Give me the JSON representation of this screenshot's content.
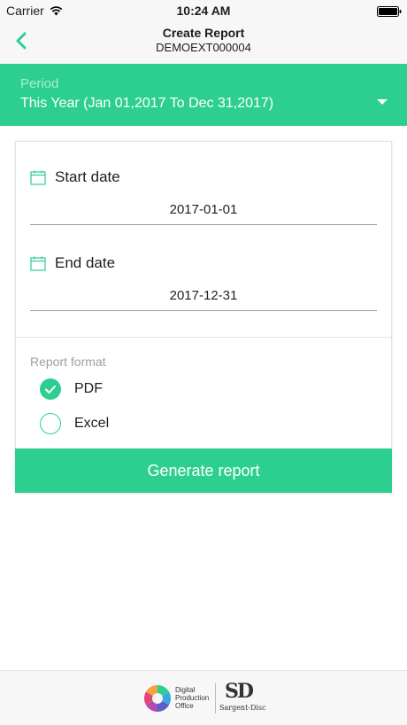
{
  "status_bar": {
    "carrier": "Carrier",
    "time": "10:24 AM"
  },
  "header": {
    "title": "Create Report",
    "subtitle": "DEMOEXT000004"
  },
  "period": {
    "label": "Period",
    "value": "This Year (Jan 01,2017 To Dec 31,2017)"
  },
  "start_date": {
    "label": "Start date",
    "value": "2017-01-01"
  },
  "end_date": {
    "label": "End date",
    "value": "2017-12-31"
  },
  "report_format": {
    "label": "Report format",
    "options": [
      {
        "label": "PDF",
        "selected": true
      },
      {
        "label": "Excel",
        "selected": false
      }
    ]
  },
  "generate_button": {
    "label": "Generate report"
  },
  "footer": {
    "dpo_text": "Digital Production Office",
    "sd_monogram": "SD",
    "sd_text": "Sargent-Disc"
  },
  "colors": {
    "accent": "#2dcf91",
    "accent_light": "#a8ecd0",
    "bar_bg": "#f7f7f7"
  }
}
